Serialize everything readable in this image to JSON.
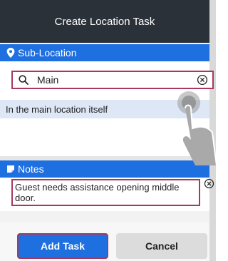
{
  "header": {
    "title": "Create Location Task"
  },
  "sublocation": {
    "section_label": "Sub-Location",
    "search_value": "Main",
    "result": "In the main location itself"
  },
  "notes": {
    "section_label": "Notes",
    "value": "Guest needs assistance opening middle door."
  },
  "actions": {
    "add_label": "Add Task",
    "cancel_label": "Cancel"
  },
  "colors": {
    "titlebar": "#2b3139",
    "accent": "#1e6fe0",
    "highlight_border": "#a8395d",
    "selected_row": "#dde7f5"
  }
}
